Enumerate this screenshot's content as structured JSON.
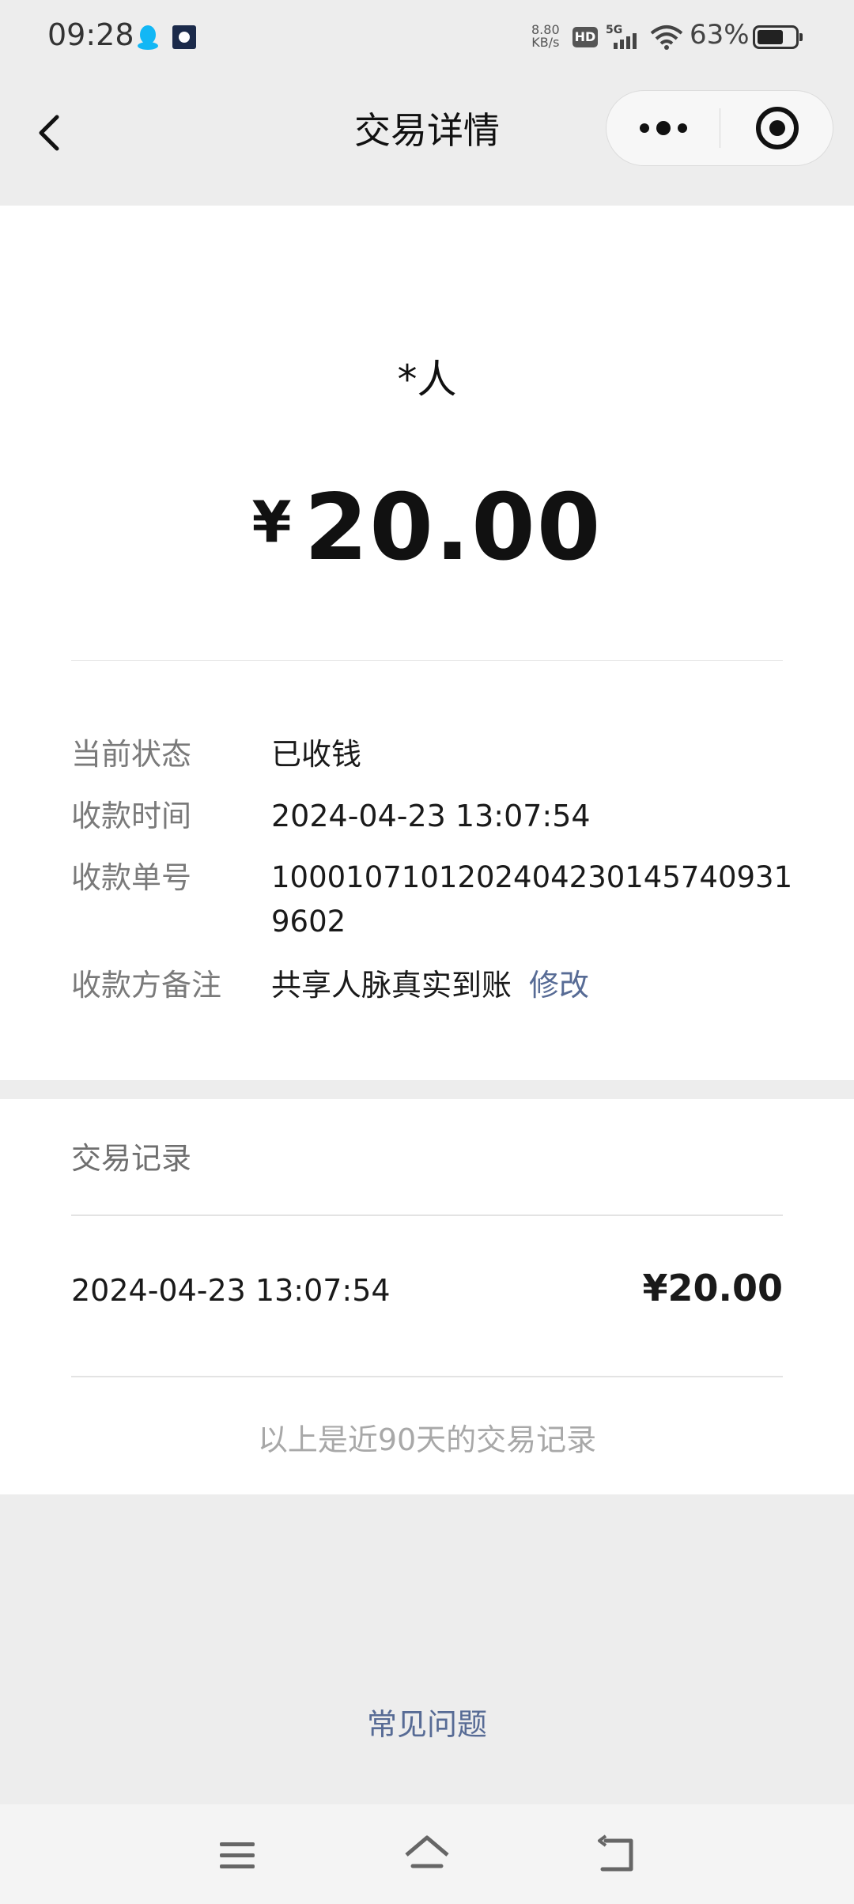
{
  "status_bar": {
    "time": "09:28",
    "net_speed_value": "8.80",
    "net_speed_unit": "KB/s",
    "hd_label": "HD",
    "signal_label": "5G",
    "battery_percent": "63%",
    "battery_level": 0.63
  },
  "navbar": {
    "title": "交易详情"
  },
  "detail": {
    "payer": "*人",
    "currency_symbol": "¥",
    "amount": "20.00",
    "rows": [
      {
        "label": "当前状态",
        "value": "已收钱"
      },
      {
        "label": "收款时间",
        "value": "2024-04-23 13:07:54"
      },
      {
        "label": "收款单号",
        "value": "100010710120240423014574093196​02"
      },
      {
        "label": "收款方备注",
        "value": "共享人脉真实到账",
        "action": "修改"
      }
    ]
  },
  "records": {
    "section_title": "交易记录",
    "items": [
      {
        "time": "2024-04-23 13:07:54",
        "amount": "¥20.00"
      }
    ],
    "footnote": "以上是近90天的交易记录"
  },
  "faq_link": "常见问题",
  "icons": {
    "back": "chevron-left-icon",
    "more": "more-dots-icon",
    "close": "target-circle-icon",
    "menu": "menu-lines-icon",
    "home": "home-icon",
    "return": "return-arrow-icon"
  },
  "colors": {
    "link": "#576b95",
    "page_bg": "#ededed",
    "card_bg": "#ffffff"
  }
}
